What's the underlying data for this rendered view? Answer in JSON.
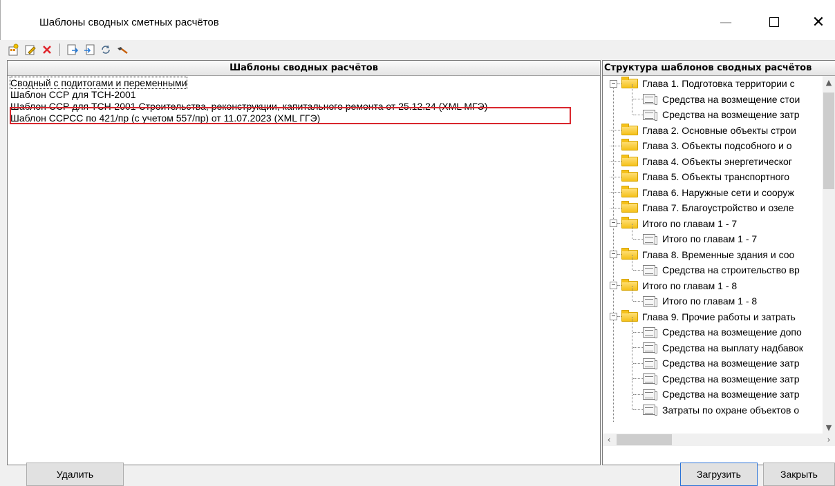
{
  "window": {
    "title": "Шаблоны сводных сметных расчётов",
    "minimize_label": "—",
    "close_label": "✕"
  },
  "left_panel": {
    "header": "Шаблоны сводных расчётов",
    "items": [
      "Сводный с подитогами и переменными",
      "Шаблон ССР для ТСН-2001",
      "Шаблон ССР для ТСН-2001 Строительства, реконструкции, капитального ремонта от 25.12.24 (XML МГЭ)",
      "Шаблон ССРСС по 421/пр (с учетом 557/пр) от 11.07.2023 (XML ГГЭ)"
    ],
    "highlight_color": "#d9262d"
  },
  "right_panel": {
    "header": "Структура шаблонов сводных расчётов",
    "tree": [
      {
        "text": "Глава  1. Подготовка территории с",
        "type": "folder",
        "level": 0,
        "expander": "−"
      },
      {
        "text": "Средства на возмещение стои",
        "type": "doc",
        "level": 1
      },
      {
        "text": "Средства на возмещение затр",
        "type": "doc",
        "level": 1
      },
      {
        "text": "Глава  2. Основные объекты строи",
        "type": "folder",
        "level": 0
      },
      {
        "text": "Глава  3. Объекты подсобного и о",
        "type": "folder",
        "level": 0
      },
      {
        "text": "Глава  4. Объекты энергетическог",
        "type": "folder",
        "level": 0
      },
      {
        "text": "Глава  5. Объекты транспортного",
        "type": "folder",
        "level": 0
      },
      {
        "text": "Глава  6. Наружные сети и сооруж",
        "type": "folder",
        "level": 0
      },
      {
        "text": "Глава  7. Благоустройство и озеле",
        "type": "folder",
        "level": 0
      },
      {
        "text": "Итого по главам 1 - 7",
        "type": "folder",
        "level": 0,
        "expander": "−"
      },
      {
        "text": "Итого по главам 1 - 7",
        "type": "doc",
        "level": 1
      },
      {
        "text": "Глава  8. Временные здания и соо",
        "type": "folder",
        "level": 0,
        "expander": "−"
      },
      {
        "text": "Средства на строительство вр",
        "type": "doc",
        "level": 1
      },
      {
        "text": "Итого по главам 1 - 8",
        "type": "folder",
        "level": 0,
        "expander": "−"
      },
      {
        "text": "Итого по главам 1 - 8",
        "type": "doc",
        "level": 1
      },
      {
        "text": "Глава  9. Прочие работы и затрать",
        "type": "folder",
        "level": 0,
        "expander": "−"
      },
      {
        "text": "Средства на возмещение допо",
        "type": "doc",
        "level": 1
      },
      {
        "text": "Средства на выплату надбавок",
        "type": "doc",
        "level": 1
      },
      {
        "text": "Средства на возмещение затр",
        "type": "doc",
        "level": 1
      },
      {
        "text": "Средства на возмещение затр",
        "type": "doc",
        "level": 1
      },
      {
        "text": "Средства на возмещение затр",
        "type": "doc",
        "level": 1
      },
      {
        "text": "Затраты по охране объектов о",
        "type": "doc",
        "level": 1
      }
    ]
  },
  "buttons": {
    "delete": "Удалить",
    "load": "Загрузить",
    "close": "Закрыть"
  },
  "toolbar": {
    "icons": [
      "new-template-icon",
      "edit-icon",
      "delete-icon",
      "export-icon",
      "import-icon",
      "refresh-icon",
      "hammer-icon"
    ]
  }
}
